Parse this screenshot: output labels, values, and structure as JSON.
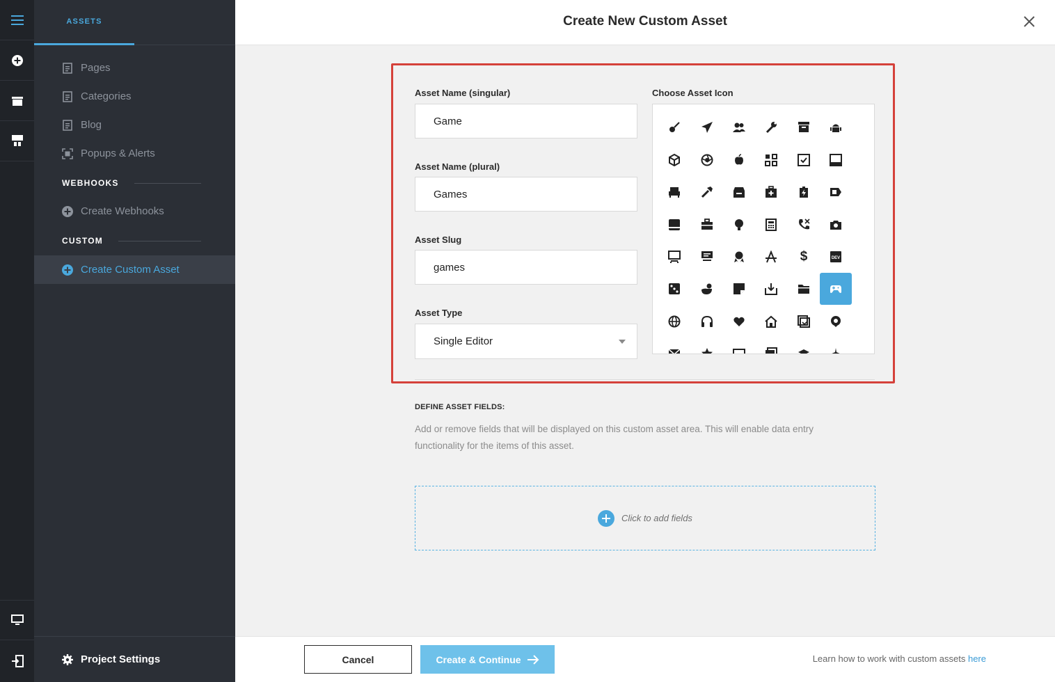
{
  "rail": {
    "icons": [
      "hamburger-menu-icon",
      "add-circle-icon",
      "archive-icon",
      "template-icon",
      "desktop-preview-icon",
      "exit-icon"
    ]
  },
  "sidebar": {
    "tab_label": "ASSETS",
    "items": [
      {
        "label": "Pages",
        "icon": "page-icon"
      },
      {
        "label": "Categories",
        "icon": "page-icon"
      },
      {
        "label": "Blog",
        "icon": "page-icon"
      },
      {
        "label": "Popups & Alerts",
        "icon": "popup-icon"
      }
    ],
    "webhooks_heading": "WEBHOOKS",
    "webhooks_item": "Create Webhooks",
    "custom_heading": "CUSTOM",
    "custom_item": "Create Custom Asset",
    "project_settings": "Project Settings"
  },
  "modal": {
    "title": "Create New Custom Asset",
    "singular_label": "Asset Name (singular)",
    "singular_value": "Game",
    "plural_label": "Asset Name (plural)",
    "plural_value": "Games",
    "slug_label": "Asset Slug",
    "slug_value": "games",
    "type_label": "Asset Type",
    "type_value": "Single Editor",
    "icon_label": "Choose Asset Icon",
    "selected_icon": "gamepad-icon",
    "define_title": "DEFINE ASSET FIELDS:",
    "define_desc": "Add or remove fields that will be displayed on this custom asset area. This will enable data entry functionality for the items of this asset.",
    "add_fields_label": "Click to add fields"
  },
  "footer": {
    "cancel_label": "Cancel",
    "create_label": "Create & Continue",
    "learn_text": "Learn how to work with custom assets",
    "learn_link": "here"
  },
  "colors": {
    "accent": "#4aa8dd",
    "highlight_border": "#d5413a",
    "rail_bg": "#202328",
    "sidebar_bg": "#2b2f36"
  }
}
